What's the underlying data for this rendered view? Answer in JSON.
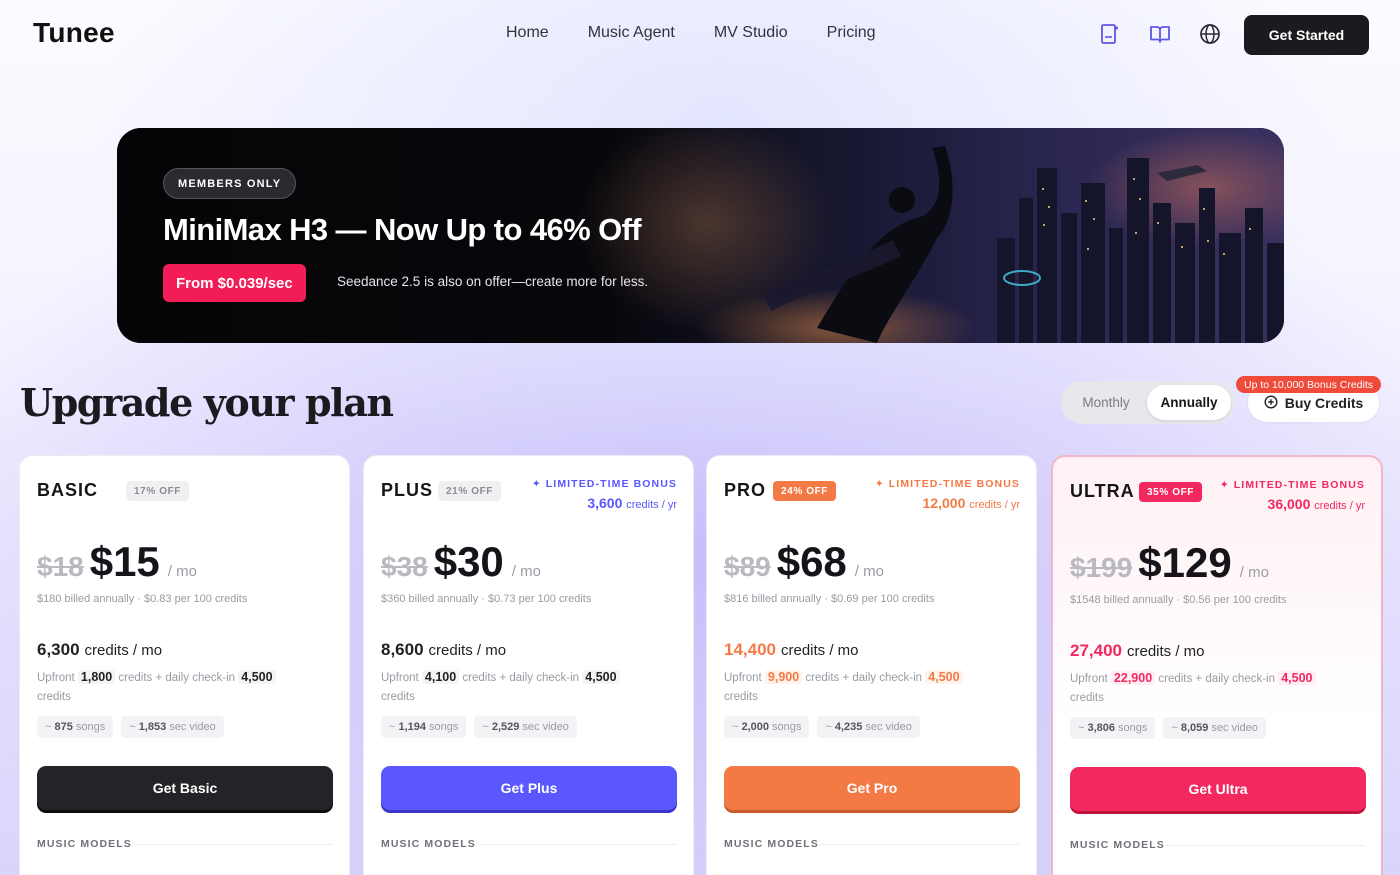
{
  "nav": {
    "logo": "Tunee",
    "links": [
      "Home",
      "Music Agent",
      "MV Studio",
      "Pricing"
    ],
    "cta": "Get Started",
    "icons": [
      "add-document-icon",
      "book-icon",
      "globe-icon"
    ]
  },
  "banner": {
    "pill": "MEMBERS ONLY",
    "title": "MiniMax H3 — Now Up to 46% Off",
    "price_badge": "From $0.039/sec",
    "subtitle": "Seedance 2.5 is also on offer—create more for less."
  },
  "heading": "Upgrade your plan",
  "billing": {
    "monthly": "Monthly",
    "annually": "Annually",
    "selected": "Annually"
  },
  "buy_credits": {
    "label": "Buy Credits",
    "tag": "Up to 10,000 Bonus Credits"
  },
  "colors": {
    "basic": "#242428",
    "plus": "#5a57ff",
    "pro": "#f47a45",
    "ultra": "#f2285e",
    "bonus_plus": "#5a57ff",
    "bonus_pro": "#f47a45",
    "bonus_ultra": "#f2285e"
  },
  "plans": [
    {
      "name": "BASIC",
      "off": "17% OFF",
      "bonus_label": "",
      "bonus_value": "",
      "bonus_unit": "",
      "old_price": "$18",
      "price": "$15",
      "per": "/ mo",
      "billed": "$180 billed annually · $0.83 per 100 credits",
      "credits": "6,300",
      "credits_unit": "credits / mo",
      "upfront_prefix": "Upfront",
      "upfront": "1,800",
      "upfront_mid": "credits + daily check-in",
      "checkin": "4,500",
      "upfront_suffix": "credits",
      "songs": "875",
      "songs_label": "songs",
      "video": "1,853",
      "video_label": "sec video",
      "cta": "Get Basic",
      "section": "MUSIC MODELS"
    },
    {
      "name": "PLUS",
      "off": "21% OFF",
      "bonus_label": "✦ LIMITED-TIME BONUS",
      "bonus_value": "3,600",
      "bonus_unit": "credits / yr",
      "old_price": "$38",
      "price": "$30",
      "per": "/ mo",
      "billed": "$360 billed annually · $0.73 per 100 credits",
      "credits": "8,600",
      "credits_unit": "credits / mo",
      "upfront_prefix": "Upfront",
      "upfront": "4,100",
      "upfront_mid": "credits + daily check-in",
      "checkin": "4,500",
      "upfront_suffix": "credits",
      "songs": "1,194",
      "songs_label": "songs",
      "video": "2,529",
      "video_label": "sec video",
      "cta": "Get Plus",
      "section": "MUSIC MODELS"
    },
    {
      "name": "PRO",
      "off": "24% OFF",
      "bonus_label": "✦ LIMITED-TIME BONUS",
      "bonus_value": "12,000",
      "bonus_unit": "credits / yr",
      "old_price": "$89",
      "price": "$68",
      "per": "/ mo",
      "billed": "$816 billed annually · $0.69 per 100 credits",
      "credits": "14,400",
      "credits_unit": "credits / mo",
      "upfront_prefix": "Upfront",
      "upfront": "9,900",
      "upfront_mid": "credits + daily check-in",
      "checkin": "4,500",
      "upfront_suffix": "credits",
      "songs": "2,000",
      "songs_label": "songs",
      "video": "4,235",
      "video_label": "sec video",
      "cta": "Get Pro",
      "section": "MUSIC MODELS"
    },
    {
      "name": "ULTRA",
      "off": "35% OFF",
      "bonus_label": "✦ LIMITED-TIME BONUS",
      "bonus_value": "36,000",
      "bonus_unit": "credits / yr",
      "old_price": "$199",
      "price": "$129",
      "per": "/ mo",
      "billed": "$1548 billed annually · $0.56 per 100 credits",
      "credits": "27,400",
      "credits_unit": "credits / mo",
      "upfront_prefix": "Upfront",
      "upfront": "22,900",
      "upfront_mid": "credits + daily check-in",
      "checkin": "4,500",
      "upfront_suffix": "credits",
      "songs": "3,806",
      "songs_label": "songs",
      "video": "8,059",
      "video_label": "sec video",
      "cta": "Get Ultra",
      "section": "MUSIC MODELS"
    }
  ]
}
